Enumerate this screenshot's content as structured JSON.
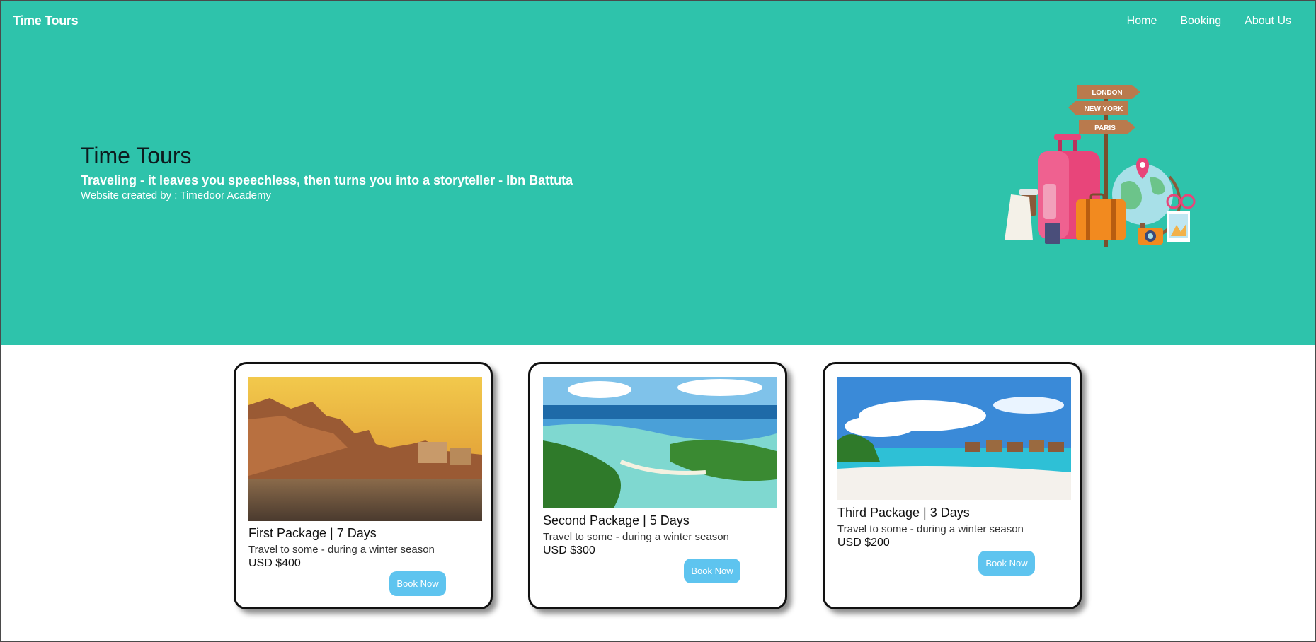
{
  "header": {
    "brand": "Time Tours",
    "nav": [
      "Home",
      "Booking",
      "About Us"
    ]
  },
  "hero": {
    "title": "Time Tours",
    "quote": "Traveling - it leaves you speechless, then turns you into a storyteller - Ibn Battuta",
    "credit": "Website created by : Timedoor Academy",
    "signs": [
      "LONDON",
      "NEW YORK",
      "PARIS"
    ]
  },
  "packages": [
    {
      "title": "First Package | 7 Days",
      "desc": "Travel to some - during a winter season",
      "price": "USD $400",
      "button": "Book Now",
      "image": "varanasi-ghats-sunset"
    },
    {
      "title": "Second Package | 5 Days",
      "desc": "Travel to some - during a winter season",
      "price": "USD $300",
      "button": "Book Now",
      "image": "tropical-lagoon-aerial"
    },
    {
      "title": "Third Package | 3 Days",
      "desc": "Travel to some - during a winter season",
      "price": "USD $200",
      "button": "Book Now",
      "image": "maldives-beach-villas"
    }
  ],
  "colors": {
    "hero_bg": "#2ec3ab",
    "button_bg": "#5ec4ef",
    "card_border": "#111111"
  }
}
